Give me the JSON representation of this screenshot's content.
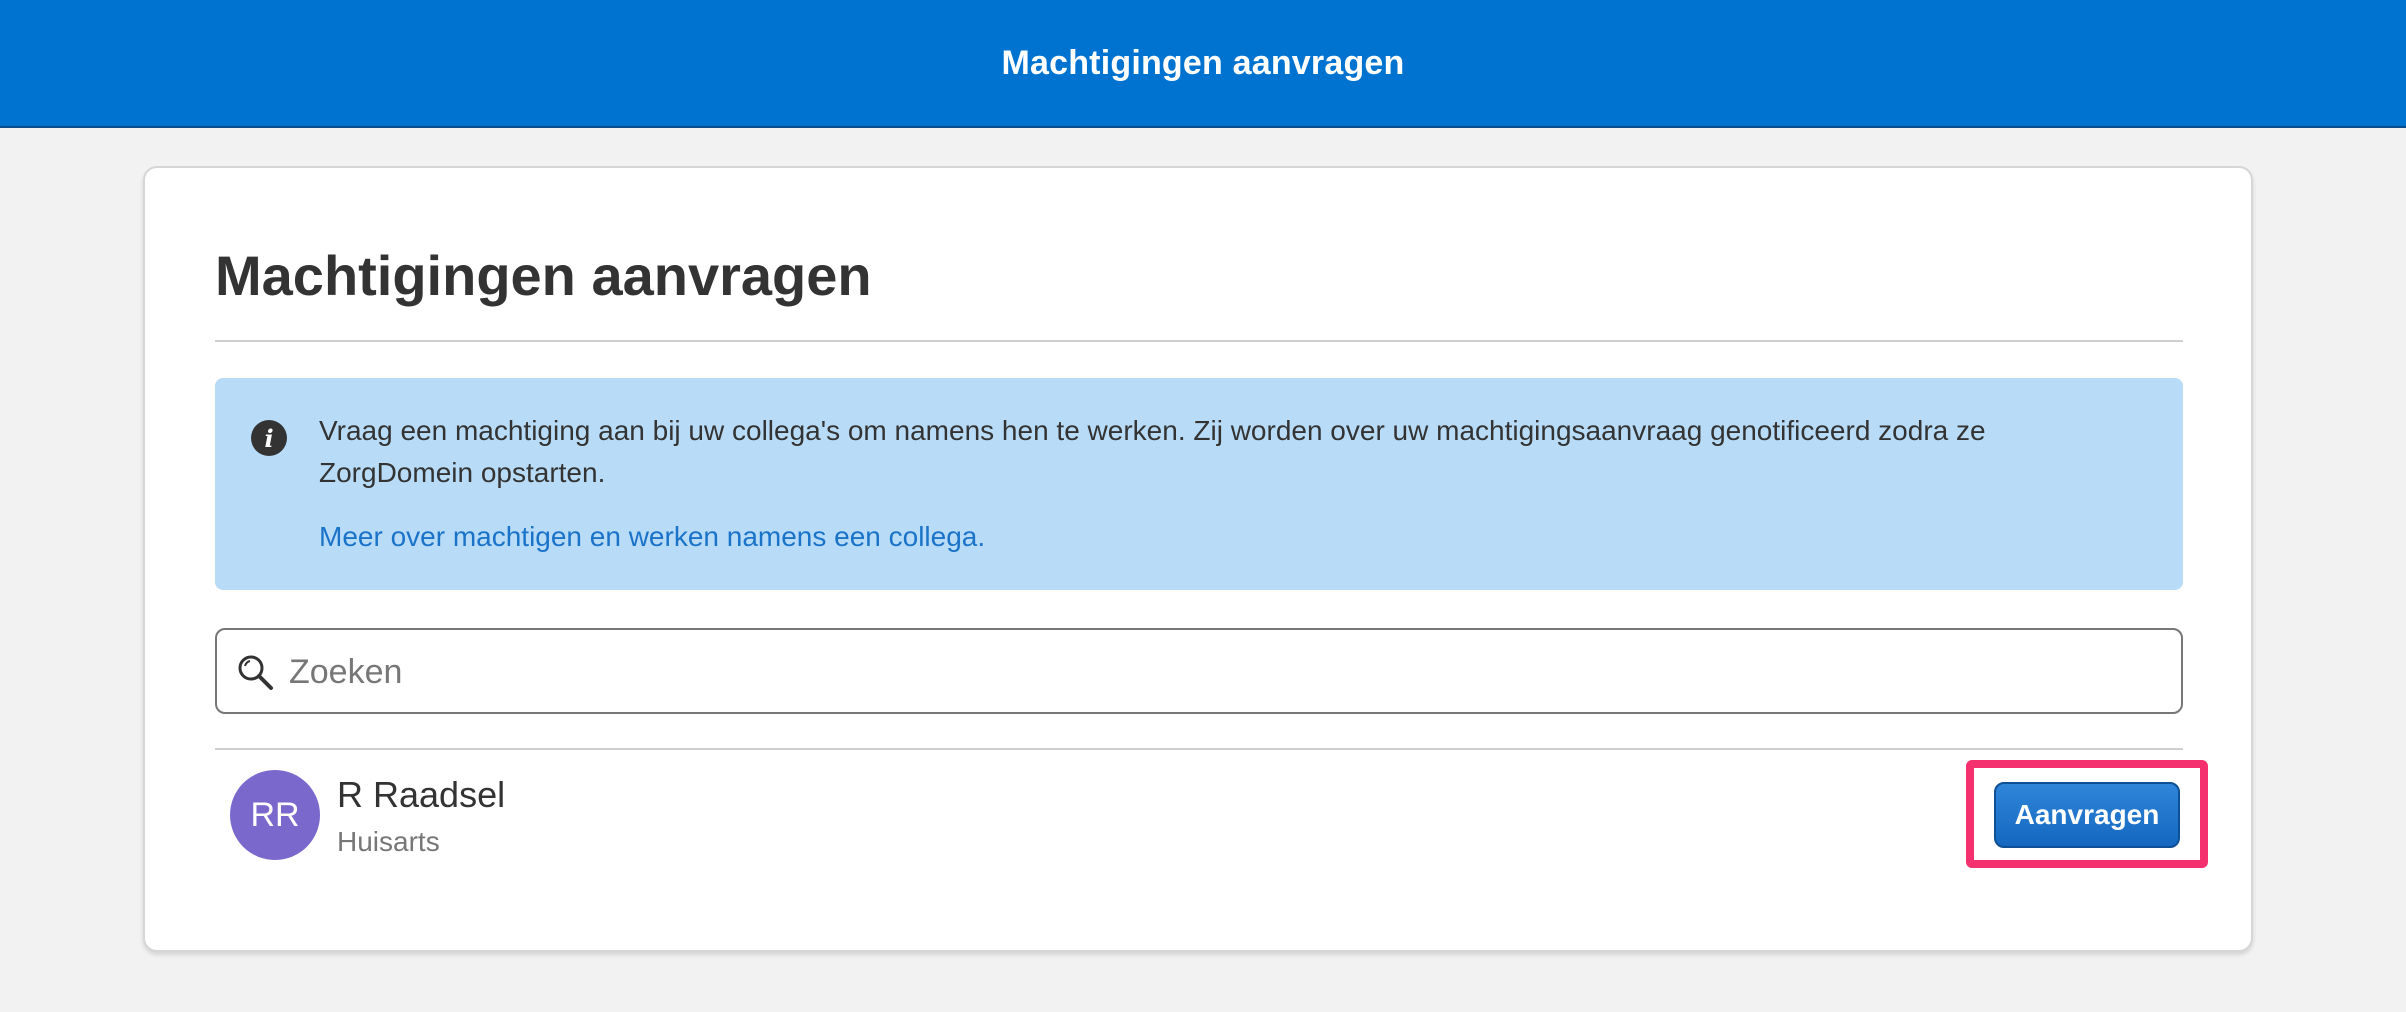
{
  "header": {
    "title": "Machtigingen aanvragen"
  },
  "card": {
    "title": "Machtigingen aanvragen",
    "info": {
      "text": "Vraag een machtiging aan bij uw collega's om namens hen te werken. Zij worden over uw machtigingsaanvraag genotificeerd zodra ze ZorgDomein opstarten.",
      "link_label": "Meer over machtigen en werken namens een collega.",
      "icon": "info-icon"
    },
    "search": {
      "placeholder": "Zoeken",
      "value": "",
      "icon": "search-icon"
    },
    "colleagues": [
      {
        "initials": "RR",
        "name": "R Raadsel",
        "role": "Huisarts",
        "button_label": "Aanvragen",
        "avatar_color": "#7b68cc"
      }
    ]
  },
  "colors": {
    "brand": "#0073d1",
    "info_background": "#b8dcf8",
    "link": "#1a73c8",
    "highlight": "#f4306f"
  }
}
